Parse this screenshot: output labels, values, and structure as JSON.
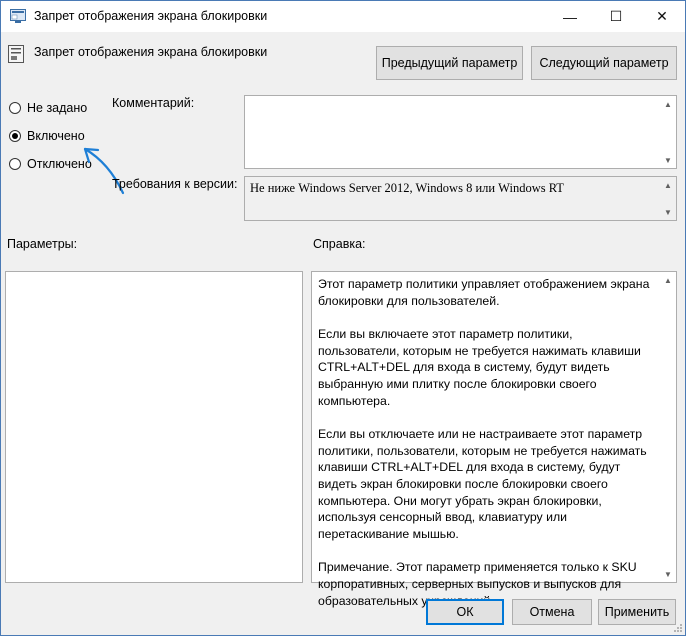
{
  "window": {
    "title": "Запрет отображения экрана блокировки",
    "minimize": "—",
    "maximize": "☐",
    "close": "✕"
  },
  "header": {
    "policy_title": "Запрет отображения экрана блокировки",
    "prev_button": "Предыдущий параметр",
    "next_button": "Следующий параметр"
  },
  "state": {
    "options": [
      "Не задано",
      "Включено",
      "Отключено"
    ],
    "selected": "Включено"
  },
  "comment": {
    "label": "Комментарий:",
    "value": ""
  },
  "requirements": {
    "label": "Требования к версии:",
    "value": "Не ниже Windows Server 2012, Windows 8 или Windows RT"
  },
  "params": {
    "label": "Параметры:"
  },
  "help": {
    "label": "Справка:",
    "paragraphs": [
      "Этот параметр политики управляет отображением экрана блокировки для пользователей.",
      "Если вы включаете этот параметр политики, пользователи, которым не требуется нажимать клавиши CTRL+ALT+DEL для входа в систему, будут видеть выбранную ими плитку после блокировки своего компьютера.",
      "Если вы отключаете или не настраиваете этот параметр политики, пользователи, которым не требуется нажимать клавиши CTRL+ALT+DEL для входа в систему, будут видеть экран блокировки после блокировки своего компьютера. Они могут убрать экран блокировки, используя сенсорный ввод, клавиатуру или перетаскивание мышью.",
      "Примечание. Этот параметр применяется только к SKU корпоративных, серверных выпусков и выпусков для образовательных учреждений."
    ]
  },
  "footer": {
    "ok": "ОК",
    "cancel": "Отмена",
    "apply": "Применить"
  },
  "annotation": {
    "arrow_color": "#1e7fd6"
  }
}
